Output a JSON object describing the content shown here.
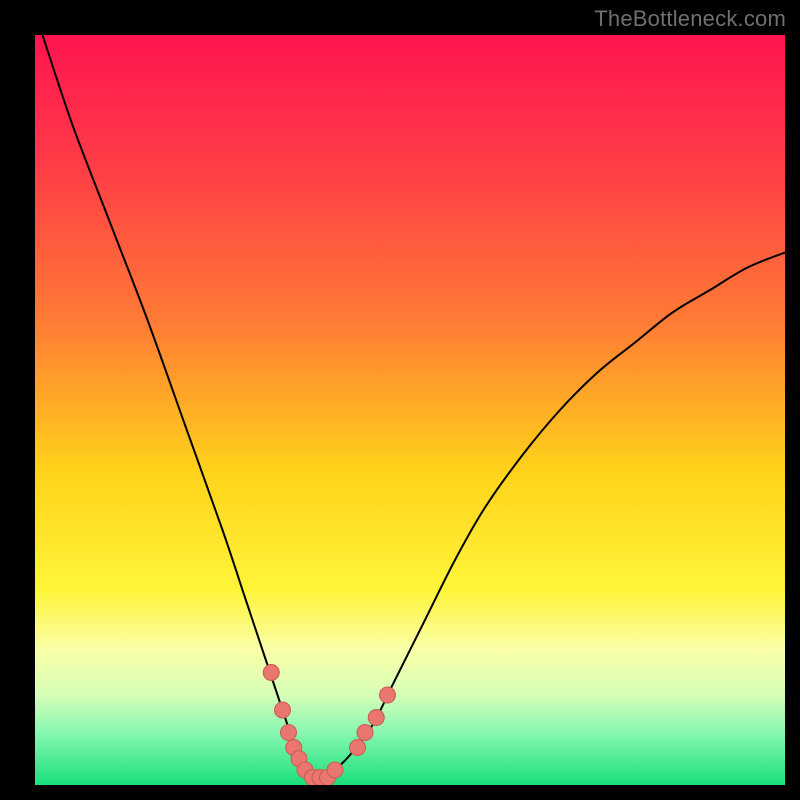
{
  "watermark": "TheBottleneck.com",
  "colors": {
    "frame": "#000000",
    "curve": "#000000",
    "point_fill": "#e9766f",
    "point_stroke": "#c95b54",
    "gradient_stops": [
      {
        "pct": 0,
        "color": "#ff1450"
      },
      {
        "pct": 18,
        "color": "#ff3e46"
      },
      {
        "pct": 38,
        "color": "#ff7a35"
      },
      {
        "pct": 58,
        "color": "#ffd21a"
      },
      {
        "pct": 74,
        "color": "#fff53a"
      },
      {
        "pct": 82,
        "color": "#f9ffa8"
      },
      {
        "pct": 88,
        "color": "#d6ffb8"
      },
      {
        "pct": 93,
        "color": "#87f7b1"
      },
      {
        "pct": 100,
        "color": "#19e07a"
      }
    ]
  },
  "chart_data": {
    "type": "line",
    "title": "",
    "xlabel": "",
    "ylabel": "",
    "xlim": [
      0,
      100
    ],
    "ylim": [
      0,
      100
    ],
    "series": [
      {
        "name": "bottleneck-curve",
        "x": [
          1,
          5,
          10,
          15,
          20,
          25,
          28,
          30,
          32,
          34,
          35,
          36,
          37,
          38,
          39,
          40,
          42,
          45,
          48,
          52,
          56,
          60,
          65,
          70,
          75,
          80,
          85,
          90,
          95,
          100
        ],
        "values": [
          100,
          88,
          75,
          62,
          48,
          34,
          25,
          19,
          13,
          7,
          4,
          2,
          1,
          1,
          1,
          2,
          4,
          8,
          14,
          22,
          30,
          37,
          44,
          50,
          55,
          59,
          63,
          66,
          69,
          71
        ]
      }
    ],
    "points": [
      {
        "x": 31.5,
        "y": 15
      },
      {
        "x": 33.0,
        "y": 10
      },
      {
        "x": 33.8,
        "y": 7
      },
      {
        "x": 34.5,
        "y": 5
      },
      {
        "x": 35.2,
        "y": 3.5
      },
      {
        "x": 36.0,
        "y": 2
      },
      {
        "x": 37.0,
        "y": 1
      },
      {
        "x": 38.0,
        "y": 1
      },
      {
        "x": 39.0,
        "y": 1
      },
      {
        "x": 40.0,
        "y": 2
      },
      {
        "x": 43.0,
        "y": 5
      },
      {
        "x": 44.0,
        "y": 7
      },
      {
        "x": 45.5,
        "y": 9
      },
      {
        "x": 47.0,
        "y": 12
      }
    ]
  }
}
